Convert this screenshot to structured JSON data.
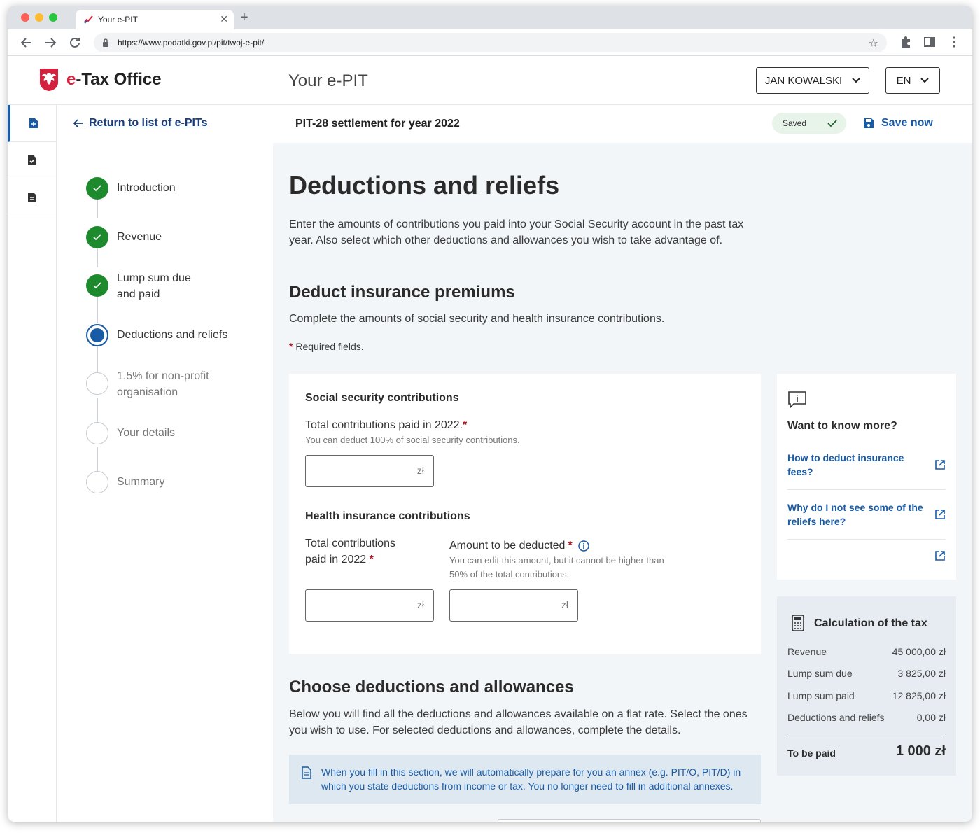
{
  "browser": {
    "tab_title": "Your e-PIT",
    "url": "https://www.podatki.gov.pl/pit/twoj-e-pit/"
  },
  "header": {
    "brand_prefix": "e",
    "brand_rest": "-Tax Office",
    "section": "Your e-PIT",
    "user": "JAN KOWALSKI",
    "language": "EN"
  },
  "subheader": {
    "back": "Return to list of e-PITs",
    "title": "PIT-28 settlement for year 2022",
    "saved": "Saved",
    "save_now": "Save now"
  },
  "steps": [
    {
      "label": "Introduction",
      "status": "done"
    },
    {
      "label": "Revenue",
      "status": "done"
    },
    {
      "label": "Lump sum due and paid",
      "status": "done"
    },
    {
      "label": "Deductions and reliefs",
      "status": "current"
    },
    {
      "label": "1.5% for non-profit organisation",
      "status": "todo"
    },
    {
      "label": "Your details",
      "status": "todo"
    },
    {
      "label": "Summary",
      "status": "todo"
    }
  ],
  "main": {
    "title": "Deductions and reliefs",
    "intro": "Enter the amounts of contributions you paid into your Social Security account in the past tax year. Also select which other deductions and allowances you wish to take advantage of.",
    "insurance_title": "Deduct insurance premiums",
    "insurance_sub": "Complete the amounts of social security and health insurance contributions.",
    "required_note": "Required fields.",
    "social": {
      "title": "Social security contributions",
      "label": "Total contributions paid in 2022.",
      "hint": "You can deduct 100% of social security contributions.",
      "unit": "zł"
    },
    "health": {
      "title": "Health insurance contributions",
      "label1": "Total contributions paid in 2022",
      "label2": "Amount to be deducted",
      "hint": "You can edit this amount, but it cannot be higher than 50% of the total contributions.",
      "unit": "zł"
    },
    "deductions_title": "Choose deductions and allowances",
    "deductions_sub": "Below you will find all the deductions and allowances available on a flat rate. Select the ones you wish to use. For selected deductions and allowances, complete the details.",
    "notice": "When you fill in this section, we will automatically prepare for you an annex (e.g. PIT/O, PIT/D) in which you state deductions from income or tax. You no longer need to fill in additional annexes."
  },
  "know_more": {
    "title": "Want to know more?",
    "links": [
      "How to deduct insurance fees?",
      "Why do I not see some of the reliefs here?"
    ]
  },
  "calculation": {
    "title": "Calculation of the tax",
    "rows": [
      {
        "label": "Revenue",
        "value": "45 000,00 zł"
      },
      {
        "label": "Lump sum due",
        "value": "3 825,00 zł"
      },
      {
        "label": "Lump sum paid",
        "value": "12 825,00 zł"
      },
      {
        "label": "Deductions and reliefs",
        "value": "0,00 zł"
      }
    ],
    "total_label": "To be paid",
    "total_value": "1 000 zł"
  },
  "colors": {
    "accent": "#1a5ba5",
    "brand_red": "#d4213d",
    "done_green": "#1e8a2e",
    "required_red": "#b5172b"
  }
}
